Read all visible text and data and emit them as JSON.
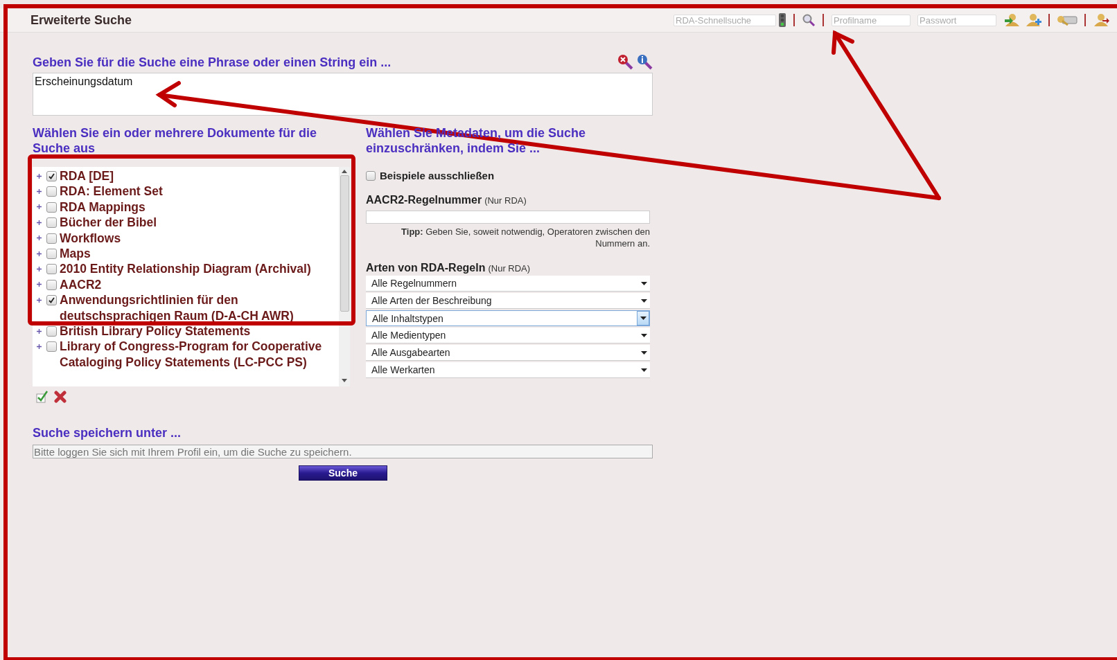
{
  "header": {
    "title": "Erweiterte Suche",
    "quick_search": {
      "placeholder": "RDA-Schnellsuche"
    },
    "profile": {
      "placeholder": "Profilname"
    },
    "password": {
      "placeholder": "Passwort"
    }
  },
  "search": {
    "heading": "Geben Sie für die Suche eine Phrase oder einen String ein ...",
    "value": "Erscheinungsdatum"
  },
  "documents": {
    "heading": "Wählen Sie ein oder mehrere Dokumente für die Suche aus",
    "items": [
      {
        "label": "RDA [DE]",
        "checked": true
      },
      {
        "label": "RDA: Element Set",
        "checked": false
      },
      {
        "label": "RDA Mappings",
        "checked": false
      },
      {
        "label": "Bücher der Bibel",
        "checked": false
      },
      {
        "label": "Workflows",
        "checked": false
      },
      {
        "label": "Maps",
        "checked": false
      },
      {
        "label": "2010 Entity Relationship Diagram (Archival)",
        "checked": false
      },
      {
        "label": "AACR2",
        "checked": false
      },
      {
        "label": "Anwendungsrichtlinien für den deutschsprachigen Raum (D-A-CH AWR)",
        "checked": true
      },
      {
        "label": "British Library Policy Statements",
        "checked": false
      },
      {
        "label": "Library of Congress-Program for Cooperative Cataloging Policy Statements (LC-PCC PS)",
        "checked": false
      }
    ]
  },
  "metadata": {
    "heading": "Wählen Sie Metadaten, um die Suche einzuschränken, indem Sie ...",
    "exclude_examples": {
      "label": "Beispiele ausschließen",
      "checked": false
    },
    "rule_number": {
      "label": "AACR2-Regelnummer",
      "note": "(Nur RDA)",
      "tip": "**Tipp:** Geben Sie, soweit notwendig, Operatoren zwischen den Nummern an."
    },
    "rule_types": {
      "label": "Arten von RDA-Regeln",
      "note": "(Nur RDA)",
      "selects": [
        {
          "value": "Alle Regelnummern",
          "focused": false
        },
        {
          "value": "Alle Arten der Beschreibung",
          "focused": false
        },
        {
          "value": "Alle Inhaltstypen",
          "focused": true
        },
        {
          "value": "Alle Medientypen",
          "focused": false
        },
        {
          "value": "Alle Ausgabearten",
          "focused": false
        },
        {
          "value": "Alle Werkarten",
          "focused": false
        }
      ]
    }
  },
  "save": {
    "heading": "Suche speichern unter ...",
    "placeholder": "Bitte loggen Sie sich mit Ihrem Profil ein, um die Suche zu speichern."
  },
  "submit": "Suche"
}
